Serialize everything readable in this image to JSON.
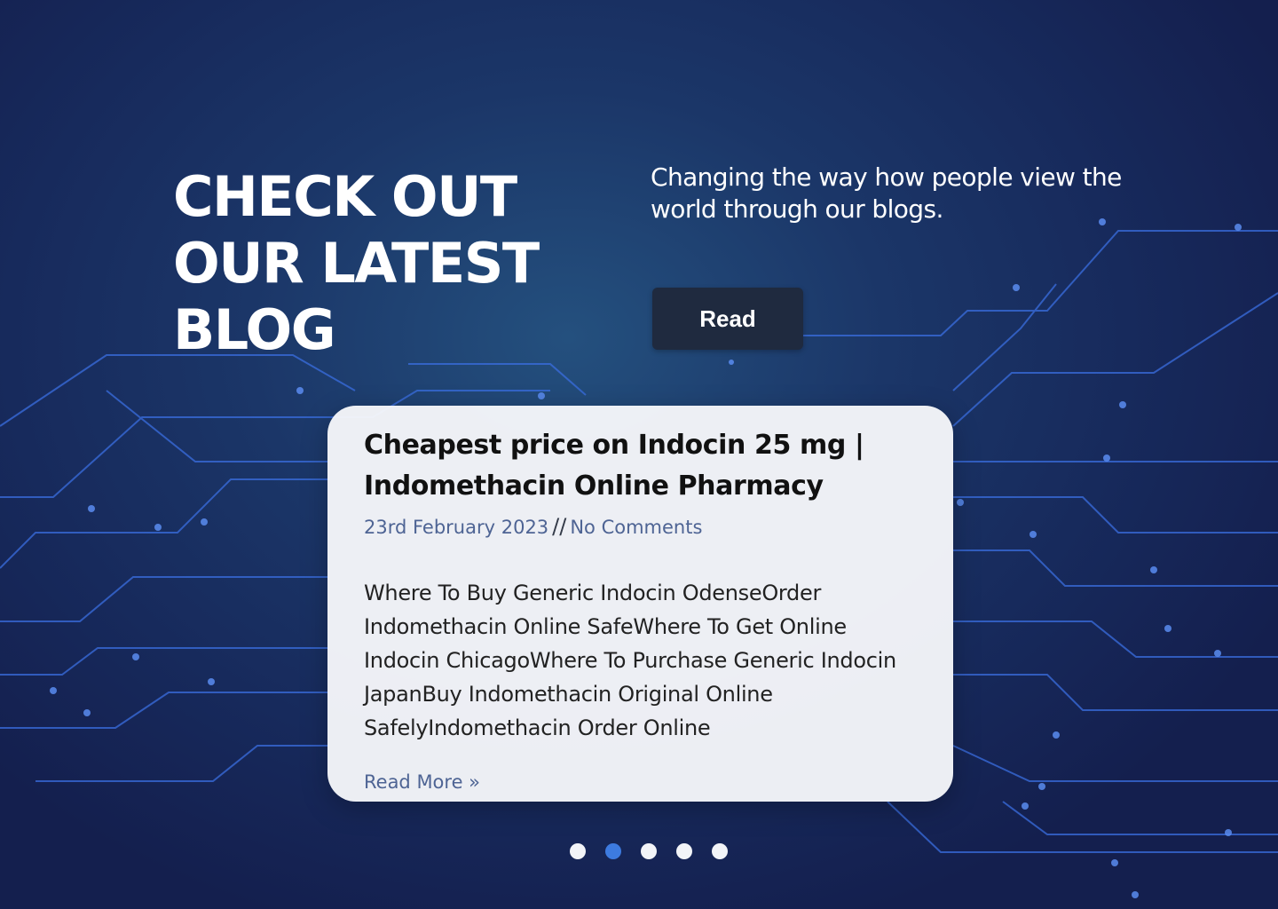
{
  "hero": {
    "heading_lines": [
      "CHECK OUT",
      "OUR LATEST",
      "BLOG"
    ],
    "tagline": "Changing the way how people view the world through our blogs.",
    "read_button_label": "Read"
  },
  "post": {
    "title": "Cheapest price on Indocin 25 mg | Indomethacin Online Pharmacy",
    "date": "23rd February 2023",
    "separator": "//",
    "comments": "No Comments",
    "excerpt": "Where To Buy Generic Indocin OdenseOrder Indomethacin Online SafeWhere To Get Online Indocin ChicagoWhere To Purchase Generic Indocin JapanBuy Indomethacin Original Online SafelyIndomethacin Order Online",
    "read_more_label": "Read More »"
  },
  "carousel": {
    "slide_count": 5,
    "active_index": 1
  },
  "colors": {
    "background": "#172a5c",
    "circuit": "#3a6ee0",
    "button": "#1f2a3f",
    "meta_text": "#4e6494",
    "dot_active": "#3d7be0",
    "dot_inactive": "#f2f4f8"
  }
}
